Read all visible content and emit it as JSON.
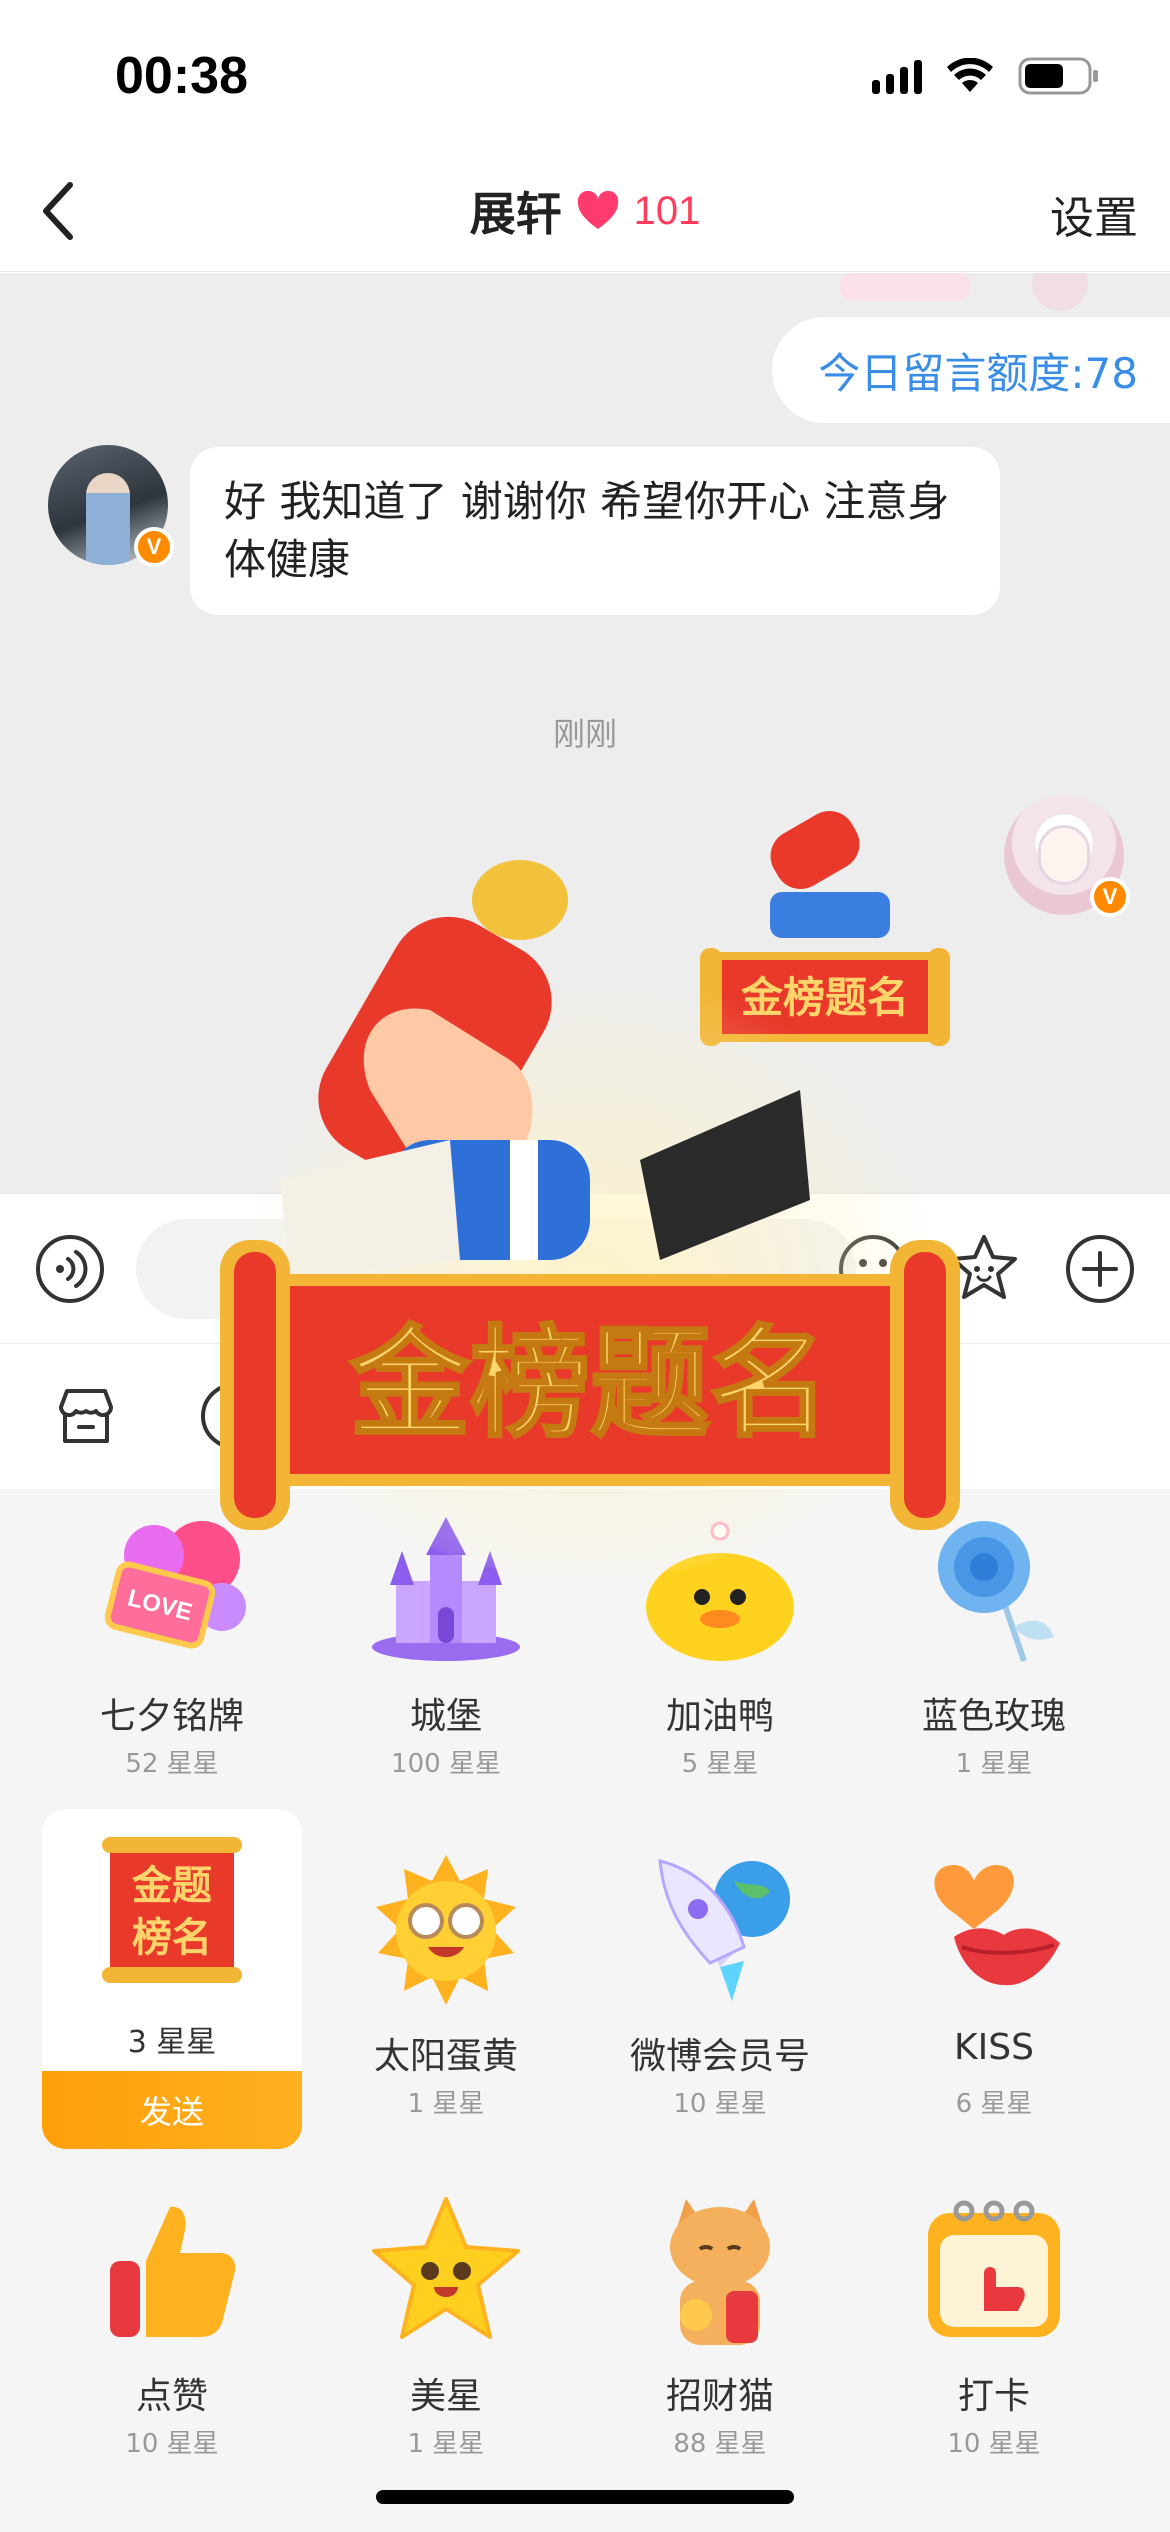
{
  "status_bar": {
    "time": "00:38"
  },
  "nav": {
    "title": "展轩",
    "intimacy": "101",
    "settings": "设置"
  },
  "chat": {
    "quota": "今日留言额度:78",
    "incoming_message": "好 我知道了 谢谢你 希望你开心 注意身体健康",
    "timestamp": "刚刚",
    "verified_badge": "V"
  },
  "effect": {
    "banner_text": "金榜题名"
  },
  "gifts": {
    "selected_send_label": "发送",
    "items": [
      {
        "name": "七夕铭牌",
        "price": "52 星星"
      },
      {
        "name": "城堡",
        "price": "100 星星"
      },
      {
        "name": "加油鸭",
        "price": "5 星星"
      },
      {
        "name": "蓝色玫瑰",
        "price": "1 星星"
      },
      {
        "name": "金榜题名",
        "price": "3 星星",
        "image_text_top": "金题",
        "image_text_bottom": "榜名"
      },
      {
        "name": "太阳蛋黄",
        "price": "1 星星"
      },
      {
        "name": "微博会员号",
        "price": "10 星星"
      },
      {
        "name": "KISS",
        "price": "6 星星"
      },
      {
        "name": "点赞",
        "price": "10 星星"
      },
      {
        "name": "美星",
        "price": "1 星星"
      },
      {
        "name": "招财猫",
        "price": "88 星星"
      },
      {
        "name": "打卡",
        "price": "10 星星"
      }
    ]
  },
  "colors": {
    "accent_blue": "#3a8de6",
    "heart_pink": "#ff3b5c",
    "send_orange": "#ff9f0a",
    "chat_bg": "#ededed"
  }
}
